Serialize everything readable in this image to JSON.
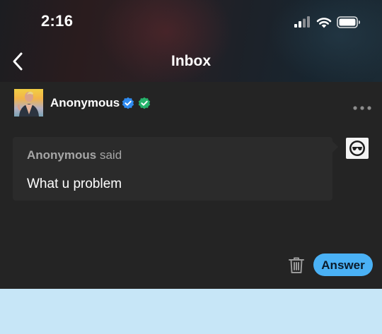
{
  "status_bar": {
    "time": "2:16",
    "icons": [
      "signal-icon",
      "wifi-icon",
      "battery-icon"
    ]
  },
  "header": {
    "back_icon": "chevron-left-icon",
    "title": "Inbox"
  },
  "post": {
    "username": "Anonymous",
    "badges": [
      {
        "icon": "verified-check-icon",
        "color": "#2f8bf0"
      },
      {
        "icon": "verified-check-icon",
        "color": "#26b36b"
      }
    ],
    "more_icon": "more-dots-icon",
    "ask": {
      "asker_name": "Anonymous",
      "said_label": "said",
      "question": "What u problem"
    },
    "actions": {
      "delete_icon": "trash-icon",
      "answer_label": "Answer"
    }
  },
  "colors": {
    "card_background": "#242424",
    "bubble_background": "#2b2b2b",
    "answer_button": "#4ab1f5",
    "page_background": "#c7e6f7"
  }
}
